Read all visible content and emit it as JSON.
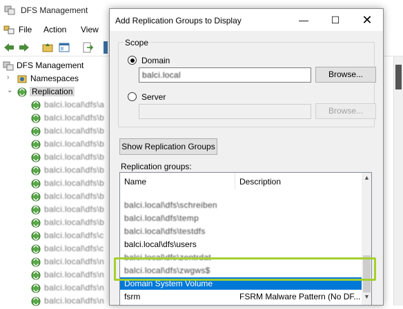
{
  "background_app": {
    "title": "DFS Management",
    "menu": [
      "File",
      "Action",
      "View"
    ],
    "tree": {
      "root": "DFS Management",
      "namespaces": "Namespaces",
      "replication": "Replication",
      "items": [
        "balci.local\\dfs\\a",
        "balci.local\\dfs\\b",
        "balci.local\\dfs\\b",
        "balci.local\\dfs\\b",
        "balci.local\\dfs\\b",
        "balci.local\\dfs\\b",
        "balci.local\\dfs\\b",
        "balci.local\\dfs\\b",
        "balci.local\\dfs\\b",
        "balci.local\\dfs\\b",
        "balci.local\\dfs\\c",
        "balci.local\\dfs\\c",
        "balci.local\\dfs\\n",
        "balci.local\\dfs\\n",
        "balci.local\\dfs\\n",
        "balci.local\\dfs\\n"
      ]
    }
  },
  "dialog": {
    "title": "Add Replication Groups to Display",
    "controls": {
      "minimize": "—",
      "maximize": "☐",
      "close": "✕"
    },
    "scope": {
      "legend": "Scope",
      "domain_label": "Domain",
      "domain_value": "balci.local",
      "browse_label": "Browse...",
      "server_label": "Server",
      "server_value": "",
      "server_browse_label": "Browse..."
    },
    "show_button": "Show Replication Groups",
    "groups_label": "Replication groups:",
    "columns": [
      "Name",
      "Description"
    ],
    "rows": [
      {
        "name": "balci.local\\dfs\\schreiben",
        "description": "",
        "blurred": true
      },
      {
        "name": "balci.local\\dfs\\temp",
        "description": "",
        "blurred": true
      },
      {
        "name": "balci.local\\dfs\\testdfs",
        "description": "",
        "blurred": true
      },
      {
        "name": "balci.local\\dfs\\users",
        "description": "",
        "blurred": false
      },
      {
        "name": "balci.local\\dfs\\zentrdat",
        "description": "",
        "blurred": true
      },
      {
        "name": "balci.local\\dfs\\zwgws$",
        "description": "",
        "blurred": true
      },
      {
        "name": "Domain System Volume",
        "description": "",
        "blurred": false,
        "selected": true
      },
      {
        "name": "fsrm",
        "description": "FSRM Malware Pattern (No DF...",
        "blurred": false
      }
    ]
  },
  "colors": {
    "selection": "#0078d7",
    "highlight_box": "#a4d02c"
  }
}
